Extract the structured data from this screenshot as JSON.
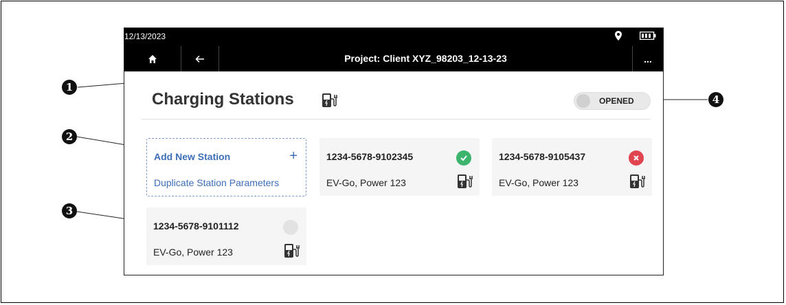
{
  "status_bar": {
    "date": "12/13/2023",
    "location_icon": "location-pin-icon",
    "battery_icon": "battery-icon"
  },
  "nav": {
    "home_icon": "home-icon",
    "back_icon": "arrow-left-icon",
    "title": "Project: Client XYZ_98203_12-13-23",
    "more_label": "..."
  },
  "header": {
    "title": "Charging Stations",
    "icon": "ev-charger-icon",
    "toggle_label": "OPENED"
  },
  "add_box": {
    "add_label": "Add New Station",
    "add_plus": "+",
    "duplicate_label": "Duplicate Station Parameters"
  },
  "stations": [
    {
      "id": "1234-5678-9102345",
      "subtitle": "EV-Go, Power 123",
      "status": "ok",
      "status_color": "#3cb46e"
    },
    {
      "id": "1234-5678-9105437",
      "subtitle": "EV-Go, Power 123",
      "status": "error",
      "status_color": "#e0444f"
    },
    {
      "id": "1234-5678-9101112",
      "subtitle": "EV-Go, Power 123",
      "status": "none",
      "status_color": "#e2e2e2"
    }
  ],
  "callouts": [
    "1",
    "2",
    "3",
    "4"
  ],
  "colors": {
    "link": "#3d6eb9",
    "bar": "#000000"
  }
}
